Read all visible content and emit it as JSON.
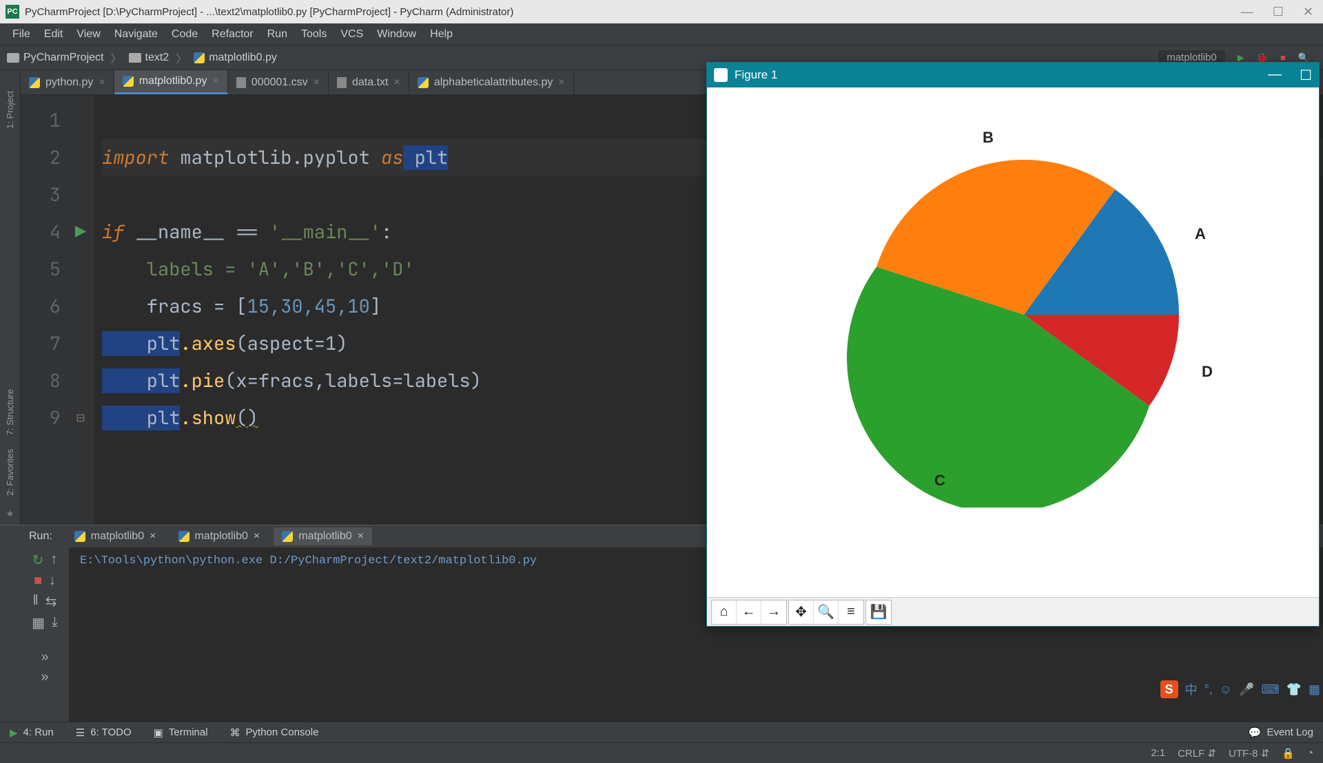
{
  "titlebar": {
    "app_icon": "PC",
    "title": "PyCharmProject [D:\\PyCharmProject] - ...\\text2\\matplotlib0.py [PyCharmProject] - PyCharm (Administrator)"
  },
  "menu": [
    "File",
    "Edit",
    "View",
    "Navigate",
    "Code",
    "Refactor",
    "Run",
    "Tools",
    "VCS",
    "Window",
    "Help"
  ],
  "breadcrumb": {
    "project": "PyCharmProject",
    "folder": "text2",
    "file": "matplotlib0.py",
    "run_config": "matplotlib0"
  },
  "editor_tabs": [
    {
      "name": "python.py",
      "icon": "py",
      "active": false
    },
    {
      "name": "matplotlib0.py",
      "icon": "py",
      "active": true
    },
    {
      "name": "000001.csv",
      "icon": "file",
      "active": false
    },
    {
      "name": "data.txt",
      "icon": "file",
      "active": false
    },
    {
      "name": "alphabeticalattributes.py",
      "icon": "py",
      "active": false
    }
  ],
  "sidebars": {
    "project": "1: Project",
    "structure": "7: Structure",
    "favorites": "2: Favorites"
  },
  "code": {
    "lines": [
      "1",
      "2",
      "3",
      "4",
      "5",
      "6",
      "7",
      "8",
      "9"
    ],
    "line2_import": "import",
    "line2_module": " matplotlib.pyplot ",
    "line2_as": "as",
    "line2_alias": " plt",
    "line4_if": "if",
    "line4_name": " __name__ ",
    "line4_eq": "==",
    "line4_main": " '__main__'",
    "line5": "    labels = 'A','B','C','D'",
    "line6_pre": "    fracs = [",
    "line6_nums": "15,30,45,10",
    "line6_post": "]",
    "line7_plt": "    plt",
    "line7_dot_axes": ".axes",
    "line7_args": "(aspect=1)",
    "line8_plt": "    plt",
    "line8_pie": ".pie",
    "line8_args": "(x=fracs,labels=labels)",
    "line9_plt": "    plt",
    "line9_show": ".show",
    "line9_paren": "()"
  },
  "run_panel": {
    "label": "Run:",
    "tabs": [
      "matplotlib0",
      "matplotlib0",
      "matplotlib0"
    ],
    "output": "E:\\Tools\\python\\python.exe D:/PyCharmProject/text2/matplotlib0.py"
  },
  "bottom_tools": {
    "run": "4: Run",
    "todo": "6: TODO",
    "terminal": "Terminal",
    "console": "Python Console",
    "eventlog": "Event Log"
  },
  "status": {
    "pos": "2:1",
    "sep": "CRLF",
    "enc": "UTF-8"
  },
  "figure": {
    "title": "Figure 1",
    "labels": {
      "A": "A",
      "B": "B",
      "C": "C",
      "D": "D"
    }
  },
  "chart_data": {
    "type": "pie",
    "categories": [
      "A",
      "B",
      "C",
      "D"
    ],
    "values": [
      15,
      30,
      45,
      10
    ],
    "colors": [
      "#1f77b4",
      "#ff7f0e",
      "#2ca02c",
      "#d62728"
    ],
    "title": "",
    "start_angle": 0,
    "direction": "counterclockwise"
  }
}
